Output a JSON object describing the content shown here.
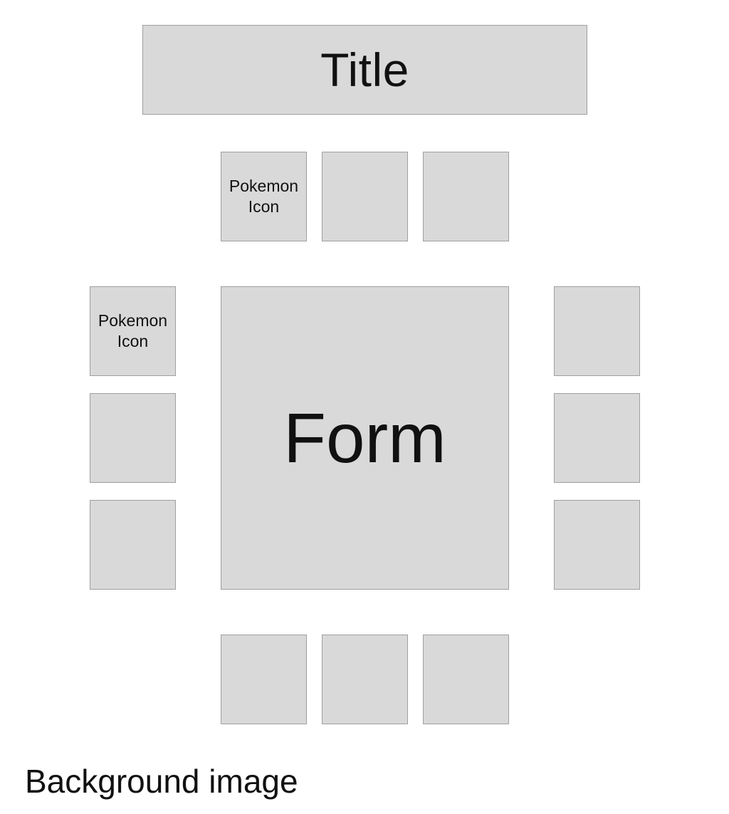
{
  "title": "Title",
  "form": "Form",
  "background_label": "Background image",
  "icons": {
    "top": [
      "Pokemon Icon",
      "",
      ""
    ],
    "left": [
      "Pokemon Icon",
      "",
      ""
    ],
    "right": [
      "",
      "",
      ""
    ],
    "bottom": [
      "",
      "",
      ""
    ]
  },
  "colors": {
    "box_fill": "#d9d9d9",
    "box_border": "#9e9e9e",
    "text": "#111111"
  }
}
